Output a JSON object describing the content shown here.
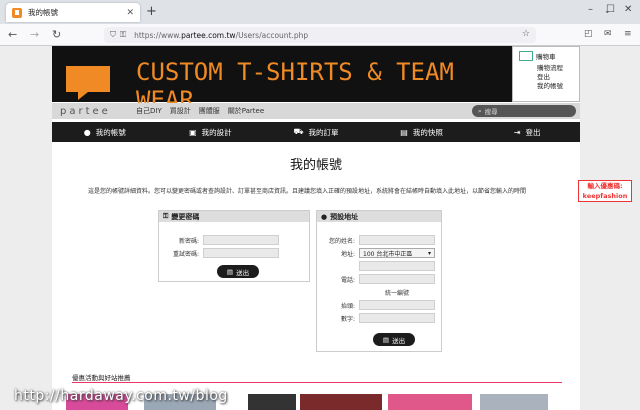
{
  "browser": {
    "tab_title": "我的帳號",
    "url_prefix": "https://www.",
    "url_host": "partee.com.tw",
    "url_path": "/Users/account.php"
  },
  "banner": {
    "text": "CUSTOM T-SHIRTS & TEAM WEAR"
  },
  "cart": {
    "label": "購物車",
    "links": [
      "購物流程",
      "登出",
      "我的帳號"
    ]
  },
  "menu": {
    "brand": "partee",
    "items": [
      "自己DIY",
      "買設計",
      "團體服",
      "關於Partee"
    ],
    "search_placeholder": "搜尋"
  },
  "account_nav": [
    {
      "label": "我的帳號",
      "icon": "user-icon"
    },
    {
      "label": "我的設計",
      "icon": "image-icon"
    },
    {
      "label": "我的訂單",
      "icon": "cart-icon"
    },
    {
      "label": "我的快照",
      "icon": "save-icon"
    },
    {
      "label": "登出",
      "icon": "logout-icon"
    }
  ],
  "page": {
    "title": "我的帳號",
    "description": "這是您的帳號詳細資料。您可以變更密碼或者查詢設計、訂單甚至商店資訊。且建議您填入正確的預設地址，系統將會在結帳時自動填入此地址，以節省您輸入的時間"
  },
  "password_panel": {
    "title": "變更密碼",
    "new_label": "新密碼:",
    "confirm_label": "重試密碼:",
    "submit": "送出"
  },
  "address_panel": {
    "title": "預設地址",
    "name_label": "您的姓名:",
    "address_label": "地址:",
    "address_value": "100 台北市中正區",
    "phone_label": "電話:",
    "invoice_label": "統一編號",
    "company_label": "抬頭:",
    "number_label": "數字:",
    "submit": "送出"
  },
  "promo": {
    "title": "優惠活動與好站推薦"
  },
  "coupon": {
    "line1": "輸入優惠碼:",
    "line2": "keepfashion"
  },
  "watermark": "http://hardaway.com.tw/blog",
  "colors": {
    "accent": "#f08a24",
    "nav_dark": "#1c1c1c",
    "coupon": "#ee3333"
  }
}
